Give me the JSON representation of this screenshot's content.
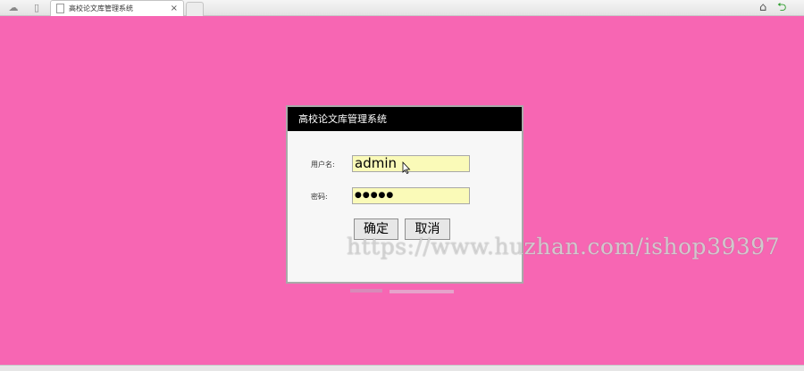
{
  "browser": {
    "tab_title": "高校论文库管理系统",
    "tab_close": "×",
    "left_icons": [
      "cloud-icon",
      "page-list-icon"
    ],
    "right_icons": [
      "home-icon",
      "back-arrow-icon"
    ]
  },
  "login": {
    "header_title": "高校论文库管理系统",
    "username_label": "用户名:",
    "username_value": "admin",
    "password_label": "密码:",
    "password_value": "●●●●●",
    "confirm_label": "确定",
    "cancel_label": "取消"
  },
  "watermark": "https://www.huzhan.com/ishop39397",
  "colors": {
    "background": "#f766b3",
    "header": "#000000",
    "input_bg": "#fafab8",
    "back_arrow": "#2e9d2e"
  }
}
